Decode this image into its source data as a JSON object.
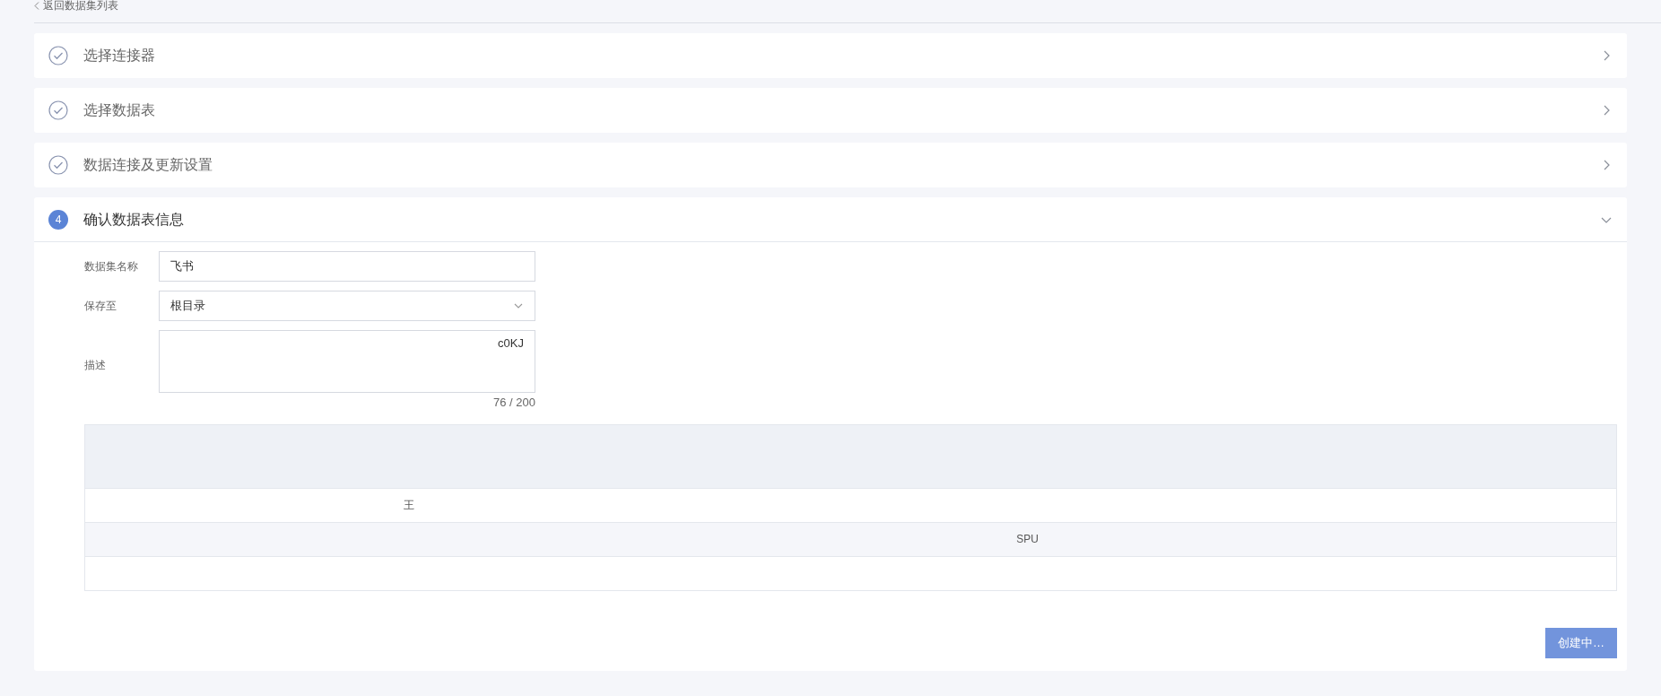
{
  "back_link": "返回数据集列表",
  "steps": [
    {
      "label": "选择连接器",
      "done": true,
      "expanded": false
    },
    {
      "label": "选择数据表",
      "done": true,
      "expanded": false
    },
    {
      "label": "数据连接及更新设置",
      "done": true,
      "expanded": false
    },
    {
      "label": "确认数据表信息",
      "number": "4",
      "done": false,
      "expanded": true
    }
  ],
  "form": [
    {
      "kind": "input",
      "label": "数据集名称",
      "value": "飞书"
    },
    {
      "kind": "select",
      "label": "保存至",
      "value": "根目录"
    },
    {
      "kind": "textarea",
      "label": "描述",
      "value": "c0KJ",
      "counter": "76 / 200"
    }
  ],
  "table": {
    "rows": [
      [
        "",
        "",
        "",
        "",
        ""
      ],
      [
        "",
        "王",
        "",
        "",
        ""
      ],
      [
        "",
        "",
        "",
        "SPU",
        ""
      ],
      [
        "",
        "",
        "",
        "",
        ""
      ]
    ]
  },
  "submit_button": {
    "label": "创建中…",
    "disabled": true
  }
}
